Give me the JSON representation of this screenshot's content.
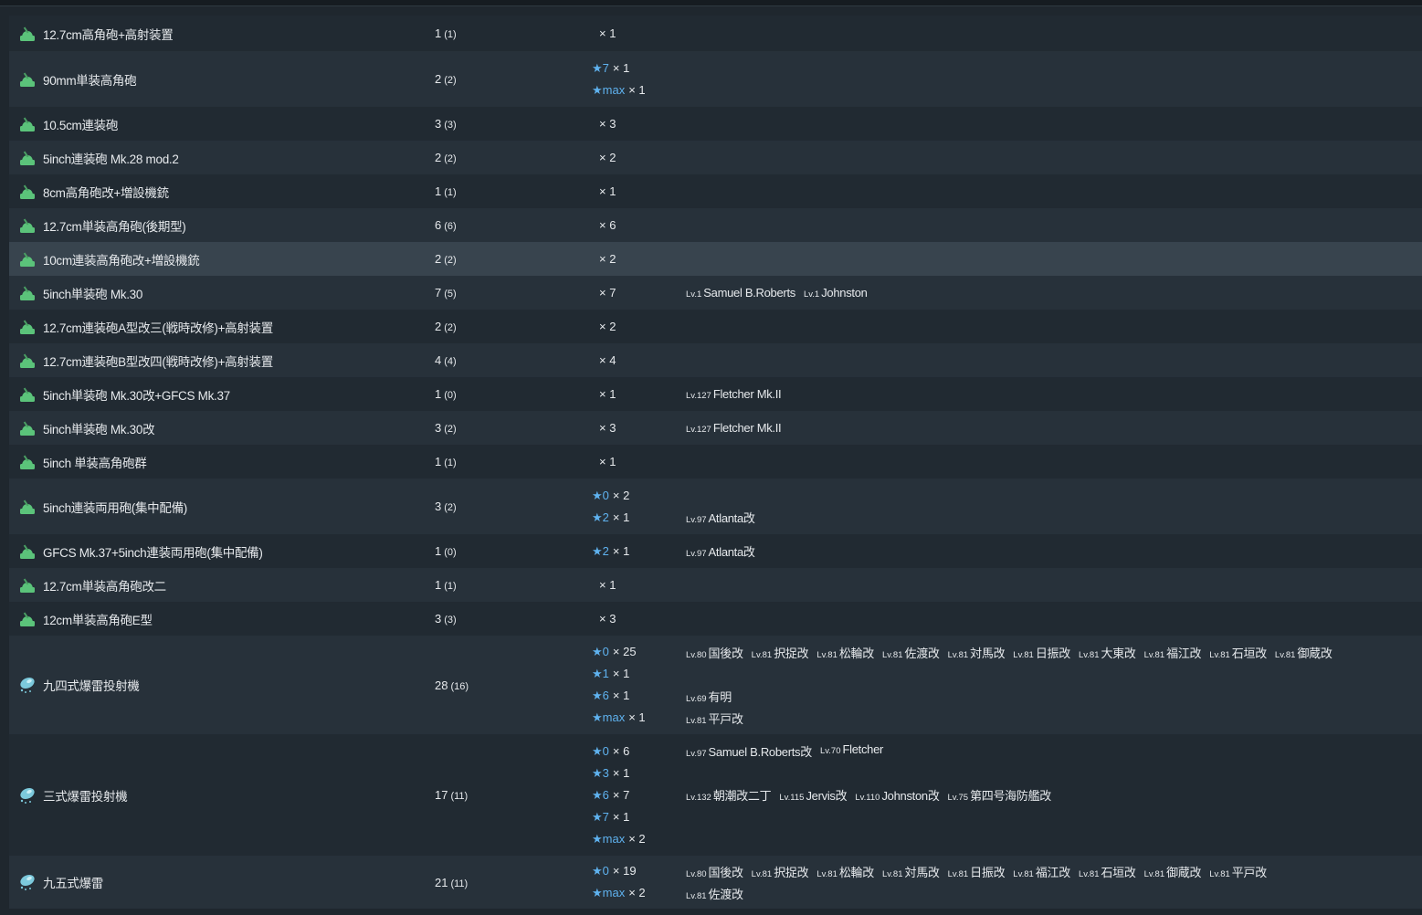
{
  "equipment": [
    {
      "icon": "aa-gun-icon",
      "name": "12.7cm高角砲+高射装置",
      "count": "1",
      "sub": "(1)",
      "h": 39,
      "groups": [
        {
          "stars": "",
          "qty": "× 1",
          "ships": []
        }
      ]
    },
    {
      "icon": "aa-gun-icon",
      "name": "90mm単装高角砲",
      "count": "2",
      "sub": "(2)",
      "h": 61,
      "groups": [
        {
          "stars": "★7",
          "qty": "× 1",
          "ships": []
        },
        {
          "stars": "★max",
          "qty": "× 1",
          "ships": []
        }
      ]
    },
    {
      "icon": "aa-gun-icon",
      "name": "10.5cm連装砲",
      "count": "3",
      "sub": "(3)",
      "h": 37,
      "groups": [
        {
          "stars": "",
          "qty": "× 3",
          "ships": []
        }
      ]
    },
    {
      "icon": "aa-gun-icon",
      "name": "5inch連装砲 Mk.28 mod.2",
      "count": "2",
      "sub": "(2)",
      "h": 37,
      "groups": [
        {
          "stars": "",
          "qty": "× 2",
          "ships": []
        }
      ]
    },
    {
      "icon": "aa-gun-icon",
      "name": "8cm高角砲改+増設機銃",
      "count": "1",
      "sub": "(1)",
      "h": 37,
      "groups": [
        {
          "stars": "",
          "qty": "× 1",
          "ships": []
        }
      ]
    },
    {
      "icon": "aa-gun-icon",
      "name": "12.7cm単装高角砲(後期型)",
      "count": "6",
      "sub": "(6)",
      "h": 37,
      "groups": [
        {
          "stars": "",
          "qty": "× 6",
          "ships": []
        }
      ]
    },
    {
      "icon": "aa-gun-icon",
      "name": "10cm連装高角砲改+増設機銃",
      "count": "2",
      "sub": "(2)",
      "h": 37,
      "highlight": true,
      "groups": [
        {
          "stars": "",
          "qty": "× 2",
          "ships": []
        }
      ]
    },
    {
      "icon": "aa-gun-icon",
      "name": "5inch単装砲 Mk.30",
      "count": "7",
      "sub": "(5)",
      "h": 37,
      "groups": [
        {
          "stars": "",
          "qty": "× 7",
          "ships": [
            {
              "lv": "Lv.1",
              "name": "Samuel B.Roberts"
            },
            {
              "lv": "Lv.1",
              "name": "Johnston"
            }
          ]
        }
      ]
    },
    {
      "icon": "aa-gun-icon",
      "name": "12.7cm連装砲A型改三(戦時改修)+高射装置",
      "count": "2",
      "sub": "(2)",
      "h": 37,
      "groups": [
        {
          "stars": "",
          "qty": "× 2",
          "ships": []
        }
      ]
    },
    {
      "icon": "aa-gun-icon",
      "name": "12.7cm連装砲B型改四(戦時改修)+高射装置",
      "count": "4",
      "sub": "(4)",
      "h": 37,
      "groups": [
        {
          "stars": "",
          "qty": "× 4",
          "ships": []
        }
      ]
    },
    {
      "icon": "aa-gun-icon",
      "name": "5inch単装砲 Mk.30改+GFCS Mk.37",
      "count": "1",
      "sub": "(0)",
      "h": 37,
      "groups": [
        {
          "stars": "",
          "qty": "× 1",
          "ships": [
            {
              "lv": "Lv.127",
              "name": "Fletcher Mk.II"
            }
          ]
        }
      ]
    },
    {
      "icon": "aa-gun-icon",
      "name": "5inch単装砲 Mk.30改",
      "count": "3",
      "sub": "(2)",
      "h": 37,
      "groups": [
        {
          "stars": "",
          "qty": "× 3",
          "ships": [
            {
              "lv": "Lv.127",
              "name": "Fletcher Mk.II"
            }
          ]
        }
      ]
    },
    {
      "icon": "aa-gun-icon",
      "name": "5inch 単装高角砲群",
      "count": "1",
      "sub": "(1)",
      "h": 37,
      "groups": [
        {
          "stars": "",
          "qty": "× 1",
          "ships": []
        }
      ]
    },
    {
      "icon": "aa-gun-icon",
      "name": "5inch連装両用砲(集中配備)",
      "count": "3",
      "sub": "(2)",
      "h": 61,
      "groups": [
        {
          "stars": "★0",
          "qty": "× 2",
          "ships": []
        },
        {
          "stars": "★2",
          "qty": "× 1",
          "ships": [
            {
              "lv": "Lv.97",
              "name": "Atlanta改"
            }
          ]
        }
      ]
    },
    {
      "icon": "aa-gun-icon",
      "name": "GFCS Mk.37+5inch連装両用砲(集中配備)",
      "count": "1",
      "sub": "(0)",
      "h": 37,
      "groups": [
        {
          "stars": "★2",
          "qty": "× 1",
          "ships": [
            {
              "lv": "Lv.97",
              "name": "Atlanta改"
            }
          ]
        }
      ]
    },
    {
      "icon": "aa-gun-icon",
      "name": "12.7cm単装高角砲改二",
      "count": "1",
      "sub": "(1)",
      "h": 37,
      "groups": [
        {
          "stars": "",
          "qty": "× 1",
          "ships": []
        }
      ]
    },
    {
      "icon": "aa-gun-icon",
      "name": "12cm単装高角砲E型",
      "count": "3",
      "sub": "(3)",
      "h": 37,
      "groups": [
        {
          "stars": "",
          "qty": "× 3",
          "ships": []
        }
      ]
    },
    {
      "icon": "depth-charge-icon",
      "name": "九四式爆雷投射機",
      "count": "28",
      "sub": "(16)",
      "h": 108,
      "groups": [
        {
          "stars": "★0",
          "qty": "× 25",
          "ships": [
            {
              "lv": "Lv.80",
              "name": "国後改"
            },
            {
              "lv": "Lv.81",
              "name": "択捉改"
            },
            {
              "lv": "Lv.81",
              "name": "松輪改"
            },
            {
              "lv": "Lv.81",
              "name": "佐渡改"
            },
            {
              "lv": "Lv.81",
              "name": "対馬改"
            },
            {
              "lv": "Lv.81",
              "name": "日振改"
            },
            {
              "lv": "Lv.81",
              "name": "大東改"
            },
            {
              "lv": "Lv.81",
              "name": "福江改"
            },
            {
              "lv": "Lv.81",
              "name": "石垣改"
            },
            {
              "lv": "Lv.81",
              "name": "御蔵改"
            }
          ]
        },
        {
          "stars": "★1",
          "qty": "× 1",
          "ships": []
        },
        {
          "stars": "★6",
          "qty": "× 1",
          "ships": [
            {
              "lv": "Lv.69",
              "name": "有明"
            }
          ]
        },
        {
          "stars": "★max",
          "qty": "× 1",
          "ships": [
            {
              "lv": "Lv.81",
              "name": "平戸改"
            }
          ]
        }
      ]
    },
    {
      "icon": "depth-charge-icon",
      "name": "三式爆雷投射機",
      "count": "17",
      "sub": "(11)",
      "h": 133,
      "groups": [
        {
          "stars": "★0",
          "qty": "× 6",
          "ships": [
            {
              "lv": "Lv.97",
              "name": "Samuel B.Roberts改"
            },
            {
              "lv": "Lv.70",
              "name": "Fletcher"
            }
          ]
        },
        {
          "stars": "★3",
          "qty": "× 1",
          "ships": []
        },
        {
          "stars": "★6",
          "qty": "× 7",
          "ships": [
            {
              "lv": "Lv.132",
              "name": "朝潮改二丁"
            },
            {
              "lv": "Lv.115",
              "name": "Jervis改"
            },
            {
              "lv": "Lv.110",
              "name": "Johnston改"
            },
            {
              "lv": "Lv.75",
              "name": "第四号海防艦改"
            }
          ]
        },
        {
          "stars": "★7",
          "qty": "× 1",
          "ships": []
        },
        {
          "stars": "★max",
          "qty": "× 2",
          "ships": []
        }
      ]
    },
    {
      "icon": "depth-charge-icon",
      "name": "九五式爆雷",
      "count": "21",
      "sub": "(11)",
      "h": 58,
      "groups": [
        {
          "stars": "★0",
          "qty": "× 19",
          "ships": [
            {
              "lv": "Lv.80",
              "name": "国後改"
            },
            {
              "lv": "Lv.81",
              "name": "択捉改"
            },
            {
              "lv": "Lv.81",
              "name": "松輪改"
            },
            {
              "lv": "Lv.81",
              "name": "対馬改"
            },
            {
              "lv": "Lv.81",
              "name": "日振改"
            },
            {
              "lv": "Lv.81",
              "name": "福江改"
            },
            {
              "lv": "Lv.81",
              "name": "石垣改"
            },
            {
              "lv": "Lv.81",
              "name": "御蔵改"
            },
            {
              "lv": "Lv.81",
              "name": "平戸改"
            }
          ]
        },
        {
          "stars": "★max",
          "qty": "× 2",
          "ships": [
            {
              "lv": "Lv.81",
              "name": "佐渡改"
            }
          ]
        }
      ]
    }
  ],
  "colors": {
    "star": "#5fb2ef",
    "aa_icon": "#5bc37a",
    "dc_icon": "#7cc9dc"
  }
}
